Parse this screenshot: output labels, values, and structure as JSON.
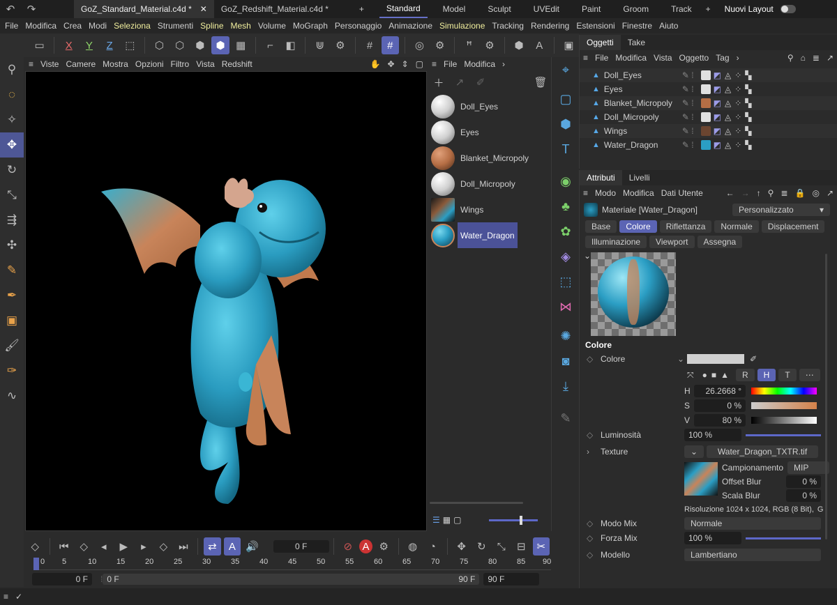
{
  "tabs": {
    "files": [
      "GoZ_Standard_Material.c4d *",
      "GoZ_Redshift_Material.c4d *"
    ],
    "add": "+",
    "layouts": [
      "Standard",
      "Model",
      "Sculpt",
      "UVEdit",
      "Paint",
      "Groom",
      "Track"
    ],
    "new_layout": "Nuovi Layout"
  },
  "menu": [
    "File",
    "Modifica",
    "Crea",
    "Modi",
    "Seleziona",
    "Strumenti",
    "Spline",
    "Mesh",
    "Volume",
    "MoGraph",
    "Personaggio",
    "Animazione",
    "Simulazione",
    "Tracking",
    "Rendering",
    "Estensioni",
    "Finestre",
    "Aiuto"
  ],
  "toolbar": {
    "x": "X",
    "y": "Y",
    "z": "Z"
  },
  "viewport": {
    "menu": [
      "Viste",
      "Camere",
      "Mostra",
      "Opzioni",
      "Filtro",
      "Vista",
      "Redshift"
    ]
  },
  "material_manager": {
    "menu": [
      "File",
      "Modifica"
    ],
    "materials": [
      {
        "name": "Doll_Eyes",
        "color": "#e8e8e8"
      },
      {
        "name": "Eyes",
        "color": "#e8e8e8"
      },
      {
        "name": "Blanket_Micropoly",
        "color": "#b56e45"
      },
      {
        "name": "Doll_Micropoly",
        "color": "#e8e8e8"
      },
      {
        "name": "Wings",
        "color": "#8a5a3a"
      },
      {
        "name": "Water_Dragon",
        "color": "#2b9ec4"
      }
    ]
  },
  "objects_panel": {
    "tabs": [
      "Oggetti",
      "Take"
    ],
    "menu": [
      "File",
      "Modifica",
      "Vista",
      "Oggetto",
      "Tag"
    ],
    "rows": [
      "Doll_Eyes",
      "Eyes",
      "Blanket_Micropoly",
      "Doll_Micropoly",
      "Wings",
      "Water_Dragon"
    ],
    "swatches": [
      "#e0e0e0",
      "#e0e0e0",
      "#b56e45",
      "#e0e0e0",
      "#6b4530",
      "#2b9ec4"
    ]
  },
  "attributes": {
    "tabs": [
      "Attributi",
      "Livelli"
    ],
    "menu": [
      "Modo",
      "Modifica",
      "Dati Utente"
    ],
    "material_title": "Materiale [Water_Dragon]",
    "preset": "Personalizzato",
    "channel_tabs_row1": [
      "Base",
      "Colore",
      "Riflettanza",
      "Normale",
      "Displacement"
    ],
    "channel_tabs_row2": [
      "Illuminazione",
      "Viewport",
      "Assegna"
    ],
    "section": "Colore",
    "color_label": "Colore",
    "mode_buttons": [
      "R",
      "H",
      "T"
    ],
    "h_label": "H",
    "h_value": "26.2668 °",
    "s_label": "S",
    "s_value": "0 %",
    "v_label": "V",
    "v_value": "80 %",
    "brightness_label": "Luminosità",
    "brightness_value": "100 %",
    "texture_label": "Texture",
    "texture_file": "Water_Dragon_TXTR.tif",
    "sampling_label": "Campionamento",
    "sampling_value": "MIP",
    "offset_blur_label": "Offset Blur",
    "offset_blur_value": "0 %",
    "scale_blur_label": "Scala Blur",
    "scale_blur_value": "0 %",
    "resolution": "Risoluzione 1024 x 1024, RGB (8 Bit),",
    "resolution_tail": "G",
    "mix_mode_label": "Modo Mix",
    "mix_mode_value": "Normale",
    "mix_strength_label": "Forza Mix",
    "mix_strength_value": "100 %",
    "model_label": "Modello",
    "model_value": "Lambertiano"
  },
  "timeline": {
    "frame": "0 F",
    "ticks": [
      "0",
      "5",
      "10",
      "15",
      "20",
      "25",
      "30",
      "35",
      "40",
      "45",
      "50",
      "55",
      "60",
      "65",
      "70",
      "75",
      "80",
      "85",
      "90"
    ],
    "start": "0 F",
    "range_start": "0 F",
    "range_end": "90 F",
    "end": "90 F"
  }
}
